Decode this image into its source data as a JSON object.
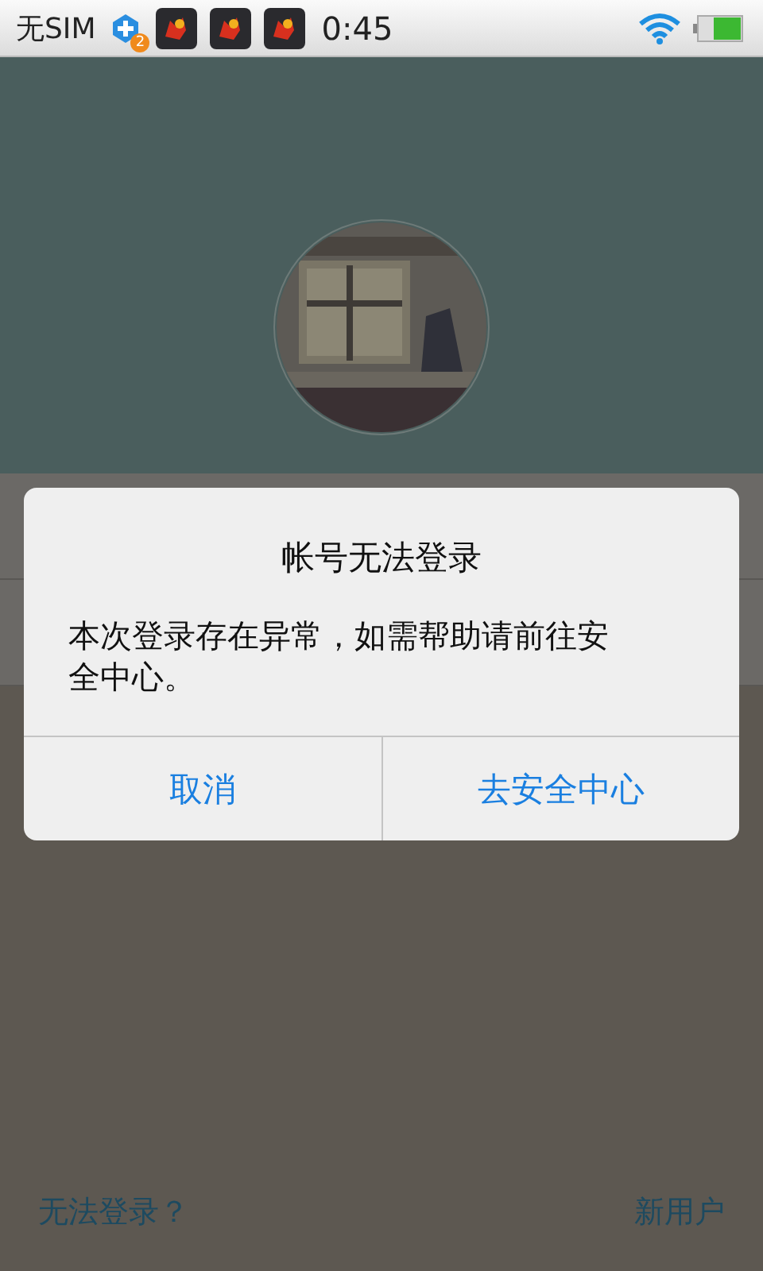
{
  "status_bar": {
    "carrier": "无SIM",
    "notification_badge": "2",
    "time": "0:45"
  },
  "dialog": {
    "title": "帐号无法登录",
    "message": "本次登录存在异常，如需帮助请前往安全中心。",
    "buttons": [
      {
        "label": "取消"
      },
      {
        "label": "去安全中心"
      }
    ]
  },
  "footer": {
    "links": [
      {
        "label": "无法登录？"
      },
      {
        "label": "新用户"
      }
    ]
  }
}
